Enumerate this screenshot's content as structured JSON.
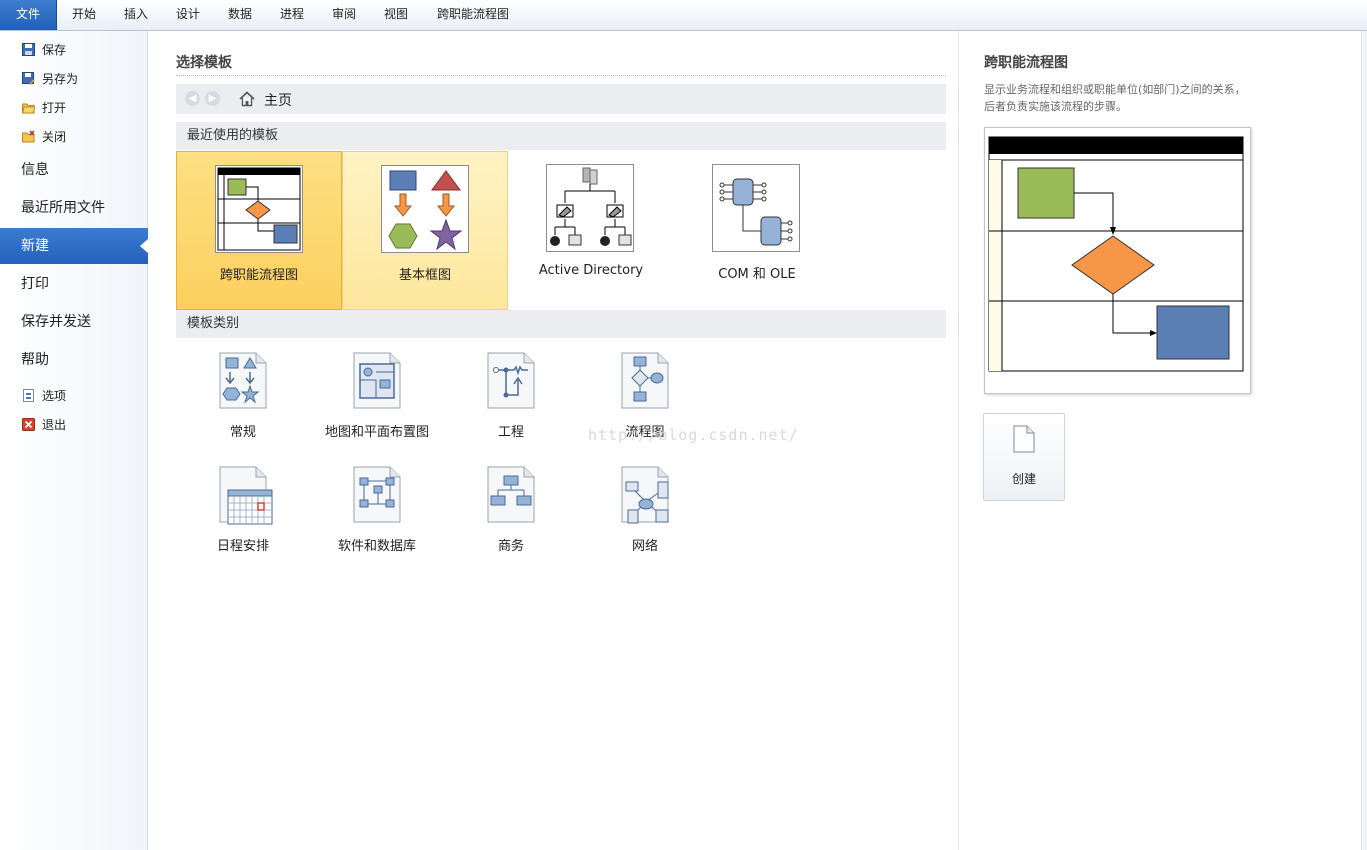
{
  "ribbon": {
    "tabs": [
      "文件",
      "开始",
      "插入",
      "设计",
      "数据",
      "进程",
      "审阅",
      "视图",
      "跨职能流程图"
    ]
  },
  "nav": {
    "save": "保存",
    "save_as": "另存为",
    "open": "打开",
    "close": "关闭",
    "info": "信息",
    "recent": "最近所用文件",
    "new": "新建",
    "print": "打印",
    "save_send": "保存并发送",
    "help": "帮助",
    "options": "选项",
    "exit": "退出"
  },
  "main": {
    "title": "选择模板",
    "breadcrumb": "主页",
    "recent_heading": "最近使用的模板",
    "recent_templates": [
      {
        "label": "跨职能流程图",
        "state": "selected"
      },
      {
        "label": "基本框图",
        "state": "hover"
      },
      {
        "label": "Active Directory",
        "state": "normal"
      },
      {
        "label": "COM 和 OLE",
        "state": "normal"
      }
    ],
    "category_heading": "模板类别",
    "categories": [
      "常规",
      "地图和平面布置图",
      "工程",
      "流程图",
      "日程安排",
      "软件和数据库",
      "商务",
      "网络"
    ],
    "watermark": "http://blog.csdn.net/"
  },
  "preview": {
    "title": "跨职能流程图",
    "description": "显示业务流程和组织或职能单位(如部门)之间的关系，后者负责实施该流程的步骤。",
    "create_label": "创建"
  },
  "colors": {
    "accent": "#2462bd",
    "selected_tile": "#fbd05e",
    "green_shape": "#9bbb59",
    "orange_shape": "#f79646",
    "blue_shape": "#5b7fb4",
    "red_shape": "#c0504d",
    "purple_shape": "#8064a2"
  }
}
